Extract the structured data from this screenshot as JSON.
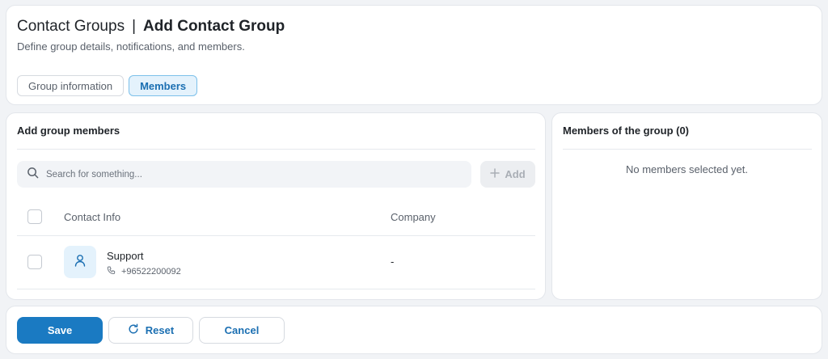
{
  "header": {
    "breadcrumb_parent": "Contact Groups",
    "separator": "|",
    "title": "Add Contact Group",
    "subtitle": "Define group details, notifications, and members."
  },
  "tabs": [
    {
      "label": "Group information",
      "active": false
    },
    {
      "label": "Members",
      "active": true
    }
  ],
  "add_members": {
    "title": "Add group members",
    "search_placeholder": "Search for something...",
    "search_value": "",
    "add_label": "Add",
    "columns": [
      "Contact Info",
      "Company"
    ],
    "rows": [
      {
        "name": "Support",
        "phone": "+96522200092",
        "company": "-",
        "icon": "user-icon"
      }
    ]
  },
  "members_panel": {
    "title": "Members of the group (0)",
    "empty_message": "No members selected yet."
  },
  "footer": {
    "save_label": "Save",
    "reset_label": "Reset",
    "cancel_label": "Cancel"
  },
  "colors": {
    "accent": "#1a7ac2",
    "active_tab_bg": "#e4f2fc",
    "page_bg": "#f1f3f6"
  }
}
